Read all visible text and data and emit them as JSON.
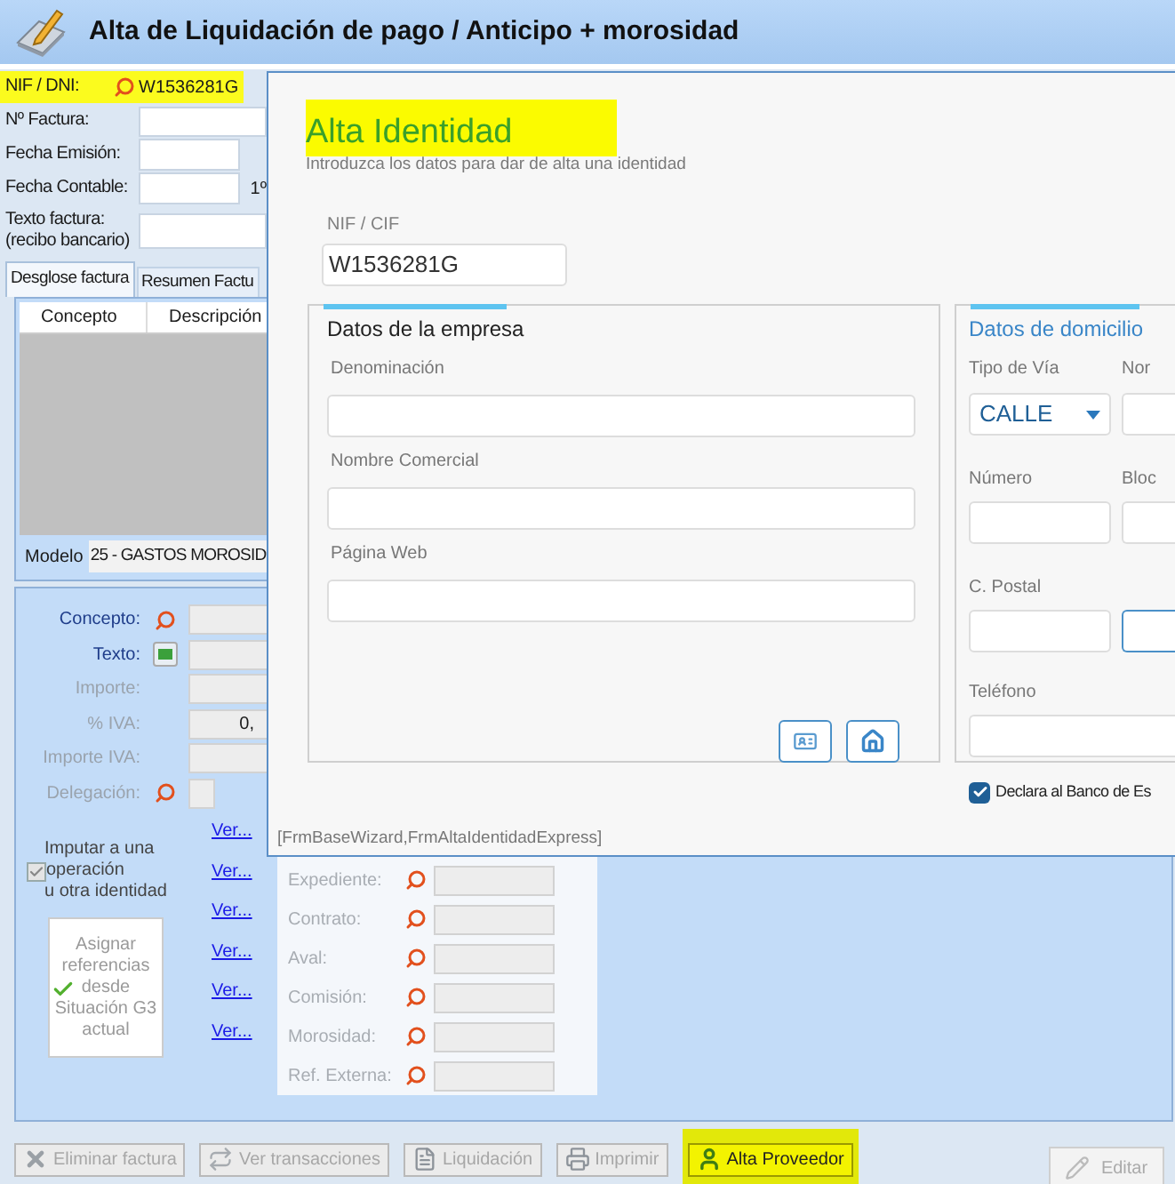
{
  "window": {
    "title": "Alta de Liquidación de pago / Anticipo + morosidad"
  },
  "header_fields": [
    {
      "label": [
        "NIF / DNI:"
      ],
      "kind": "search",
      "value": "W1536281G",
      "highlighted": true
    },
    {
      "label": [
        "Nº Factura:"
      ],
      "kind": "wide",
      "highlighted": false
    },
    {
      "label": [
        "Fecha Emisión:"
      ],
      "kind": "short",
      "highlighted": false
    },
    {
      "label": [
        "Fecha Contable:"
      ],
      "kind": "short",
      "suffix": "1º",
      "highlighted": false
    },
    {
      "label": [
        "Texto factura:",
        "(recibo bancario)"
      ],
      "kind": "wide",
      "highlighted": false
    }
  ],
  "tabs": [
    {
      "label": "Desglose factura",
      "selected": true
    },
    {
      "label": "Resumen Factu",
      "selected": false
    }
  ],
  "grid": {
    "columns": [
      "Concepto",
      "Descripción"
    ],
    "modelo_label": "Modelo",
    "modelo_value": "25 - GASTOS MOROSID"
  },
  "line_fields": [
    {
      "label": "Concepto:",
      "kind": "search",
      "disabled": false
    },
    {
      "label": "Texto:",
      "kind": "action",
      "disabled": false
    },
    {
      "label": "Importe:",
      "kind": "plain",
      "disabled": true
    },
    {
      "label": "% IVA:",
      "kind": "plain",
      "disabled": true,
      "value": "0,"
    },
    {
      "label": "Importe IVA:",
      "kind": "plain",
      "disabled": true
    },
    {
      "label": "Delegación:",
      "kind": "small",
      "disabled": true
    }
  ],
  "links": [
    "Ver...",
    "Ver...",
    "Ver...",
    "Ver...",
    "Ver...",
    "Ver..."
  ],
  "impute": {
    "lines": [
      "Imputar a una",
      "operación",
      "u otra identidad"
    ],
    "checked": true,
    "disabled": true
  },
  "assign_button": {
    "lines": [
      "Asignar",
      "referencias",
      "desde",
      "Situación G3",
      "actual"
    ],
    "disabled": true
  },
  "references": [
    {
      "label": "Expediente:"
    },
    {
      "label": "Contrato:"
    },
    {
      "label": "Aval:"
    },
    {
      "label": "Comisión:"
    },
    {
      "label": "Morosidad:"
    },
    {
      "label": "Ref. Externa:"
    }
  ],
  "toolbar": [
    {
      "label": "Eliminar factura",
      "kind": "delete",
      "disabled": true,
      "highlighted": false
    },
    {
      "label": "Ver transacciones",
      "kind": "transactions",
      "disabled": true,
      "highlighted": false
    },
    {
      "label": "Liquidación",
      "kind": "document",
      "disabled": true,
      "highlighted": false
    },
    {
      "label": "Imprimir",
      "kind": "print",
      "disabled": true,
      "highlighted": false
    },
    {
      "label": "Alta Proveedor",
      "kind": "person",
      "disabled": false,
      "highlighted": true
    }
  ],
  "edit_button": {
    "label": "Editar",
    "disabled": true
  },
  "dialog": {
    "title": "Alta Identidad",
    "title_highlighted": true,
    "subtitle": "Introduzca los datos para dar de alta una identidad",
    "nif_label": "NIF / CIF",
    "nif_value": "W1536281G",
    "company": {
      "title": "Datos de la empresa",
      "fields": [
        "Denominación",
        "Nombre Comercial",
        "Página Web"
      ]
    },
    "address": {
      "title": "Datos de domicilio",
      "via_label": "Tipo de Vía",
      "via_value": "CALLE",
      "col2_label_1": "Nor",
      "number_label": "Número",
      "col2_label_2": "Bloc",
      "postal_label": "C. Postal",
      "phone_label": "Teléfono",
      "declare": {
        "label": "Declara al Banco de Es",
        "checked": true
      }
    },
    "footer": "[FrmBaseWizard,FrmAltaIdentidadExpress]"
  }
}
